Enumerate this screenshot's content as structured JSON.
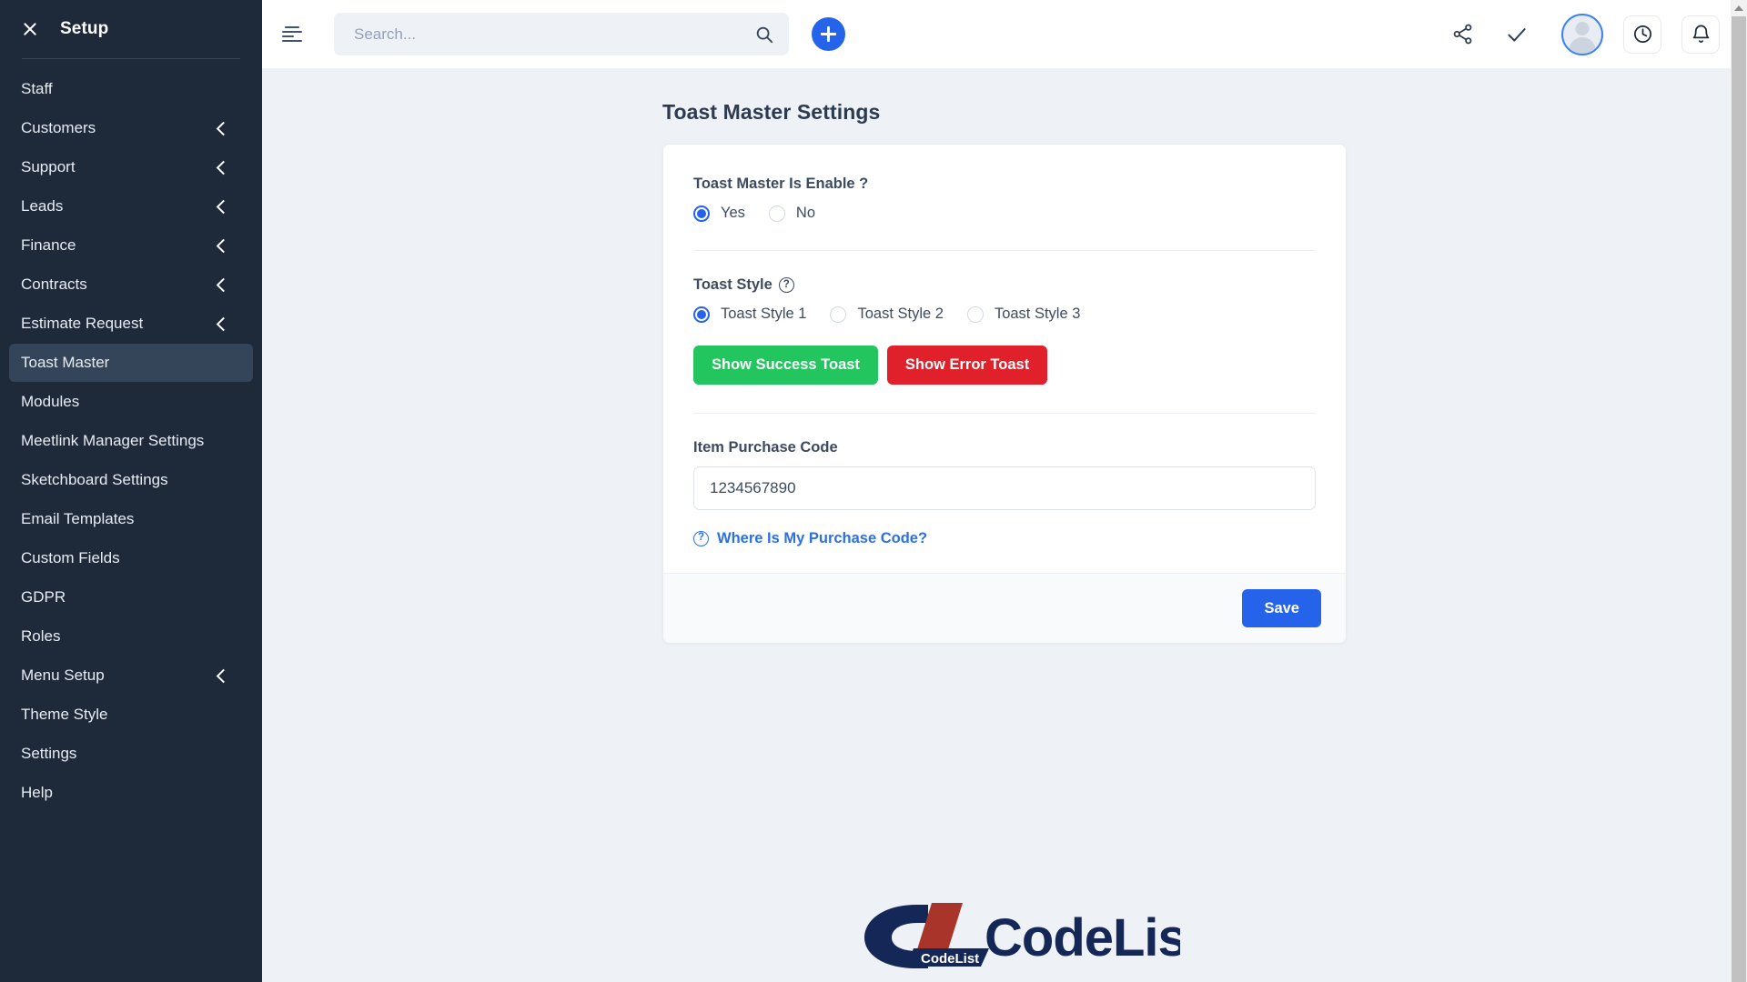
{
  "sidebar": {
    "title": "Setup",
    "close_icon": "close-icon",
    "items": [
      {
        "label": "Staff",
        "expandable": false,
        "active": false
      },
      {
        "label": "Customers",
        "expandable": true,
        "active": false
      },
      {
        "label": "Support",
        "expandable": true,
        "active": false
      },
      {
        "label": "Leads",
        "expandable": true,
        "active": false
      },
      {
        "label": "Finance",
        "expandable": true,
        "active": false
      },
      {
        "label": "Contracts",
        "expandable": true,
        "active": false
      },
      {
        "label": "Estimate Request",
        "expandable": true,
        "active": false
      },
      {
        "label": "Toast Master",
        "expandable": false,
        "active": true
      },
      {
        "label": "Modules",
        "expandable": false,
        "active": false
      },
      {
        "label": "Meetlink Manager Settings",
        "expandable": false,
        "active": false
      },
      {
        "label": "Sketchboard Settings",
        "expandable": false,
        "active": false
      },
      {
        "label": "Email Templates",
        "expandable": false,
        "active": false
      },
      {
        "label": "Custom Fields",
        "expandable": false,
        "active": false
      },
      {
        "label": "GDPR",
        "expandable": false,
        "active": false
      },
      {
        "label": "Roles",
        "expandable": false,
        "active": false
      },
      {
        "label": "Menu Setup",
        "expandable": true,
        "active": false
      },
      {
        "label": "Theme Style",
        "expandable": false,
        "active": false
      },
      {
        "label": "Settings",
        "expandable": false,
        "active": false
      },
      {
        "label": "Help",
        "expandable": false,
        "active": false
      }
    ]
  },
  "topbar": {
    "menu_toggle_icon": "hamburger-icon",
    "search": {
      "value": "",
      "placeholder": "Search..."
    },
    "search_icon": "search-icon",
    "add_button_icon": "plus-icon",
    "share_icon": "share-icon",
    "check_icon": "check-icon",
    "avatar": "user-avatar",
    "clock_icon": "clock-icon",
    "bell_icon": "bell-icon"
  },
  "page": {
    "title": "Toast Master Settings",
    "enable": {
      "label": "Toast Master Is Enable ?",
      "options": [
        "Yes",
        "No"
      ],
      "selected": "Yes"
    },
    "style": {
      "label": "Toast Style",
      "help_icon": "question-circle-icon",
      "options": [
        "Toast Style 1",
        "Toast Style 2",
        "Toast Style 3"
      ],
      "selected": "Toast Style 1"
    },
    "demo_buttons": {
      "success_label": "Show Success Toast",
      "error_label": "Show Error Toast"
    },
    "purchase_code": {
      "label": "Item Purchase Code",
      "value": "1234567890",
      "placeholder": "Item Purchase Code",
      "help_link": "Where Is My Purchase Code?",
      "help_icon": "question-circle-icon"
    },
    "save_label": "Save"
  },
  "footer": {
    "logo_mark": "CodeList",
    "logo_text": "CodeList.in"
  },
  "colors": {
    "sidebar_bg": "#1e2a3a",
    "sidebar_active": "#34455a",
    "accent": "#2563eb",
    "success": "#22c55e",
    "danger": "#e0202a",
    "link": "#2f6fe4",
    "page_bg": "#eef1f6"
  }
}
